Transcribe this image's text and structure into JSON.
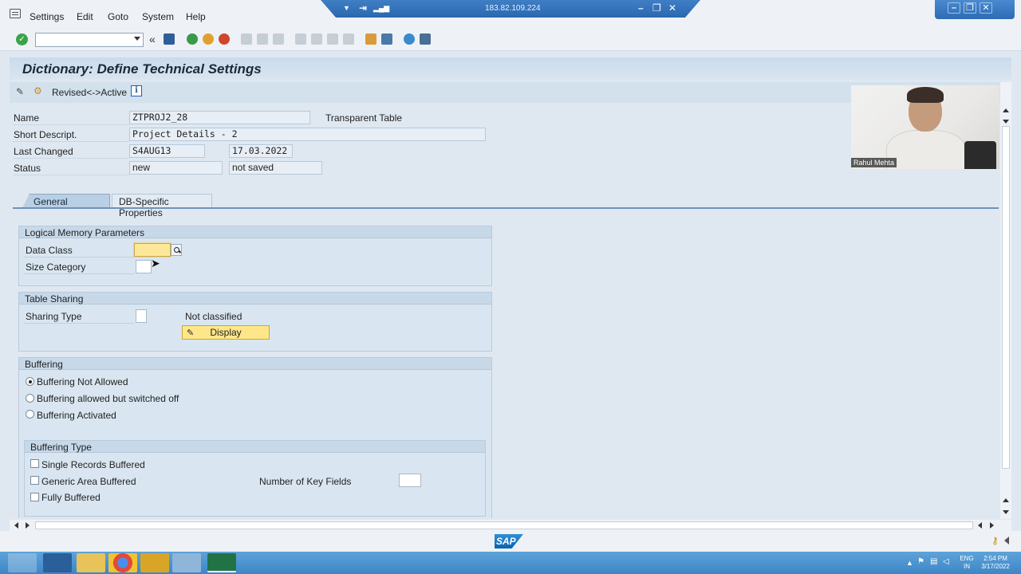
{
  "menu": {
    "items": [
      "Settings",
      "Edit",
      "Goto",
      "System",
      "Help"
    ]
  },
  "remote": {
    "ip": "183.82.109.224"
  },
  "title": "Dictionary: Define Technical Settings",
  "appbar": {
    "toggle_label": "Revised<->Active"
  },
  "header": {
    "name_label": "Name",
    "name_value": "ZTPROJ2_28",
    "table_type": "Transparent Table",
    "short_label": "Short Descript.",
    "short_value": "Project Details - 2",
    "changed_label": "Last Changed",
    "changed_user": "S4AUG13",
    "changed_date": "17.03.2022",
    "status_label": "Status",
    "status_value": "new",
    "status_save": "not saved"
  },
  "tabs": [
    {
      "label": "General Properties",
      "active": true
    },
    {
      "label": "DB-Specific Properties",
      "active": false
    }
  ],
  "logical_memory": {
    "title": "Logical Memory Parameters",
    "data_class_label": "Data Class",
    "data_class_value": "",
    "size_category_label": "Size Category",
    "size_category_value": ""
  },
  "table_sharing": {
    "title": "Table Sharing",
    "sharing_type_label": "Sharing Type",
    "sharing_type_value": "",
    "classification": "Not classified",
    "display_button": "Display"
  },
  "buffering": {
    "title": "Buffering",
    "options": [
      {
        "label": "Buffering Not Allowed",
        "selected": true
      },
      {
        "label": "Buffering allowed but switched off",
        "selected": false
      },
      {
        "label": "Buffering Activated",
        "selected": false
      }
    ],
    "type_title": "Buffering Type",
    "types": [
      {
        "label": "Single Records Buffered",
        "checked": false
      },
      {
        "label": "Generic Area Buffered",
        "checked": false
      },
      {
        "label": "Fully Buffered",
        "checked": false
      }
    ],
    "key_fields_label": "Number of Key Fields",
    "key_fields_value": ""
  },
  "webcam": {
    "name": "Rahul Mehta"
  },
  "taskbar": {
    "lang": "ENG",
    "region": "IN",
    "time": "2:54 PM",
    "date": "3/17/2022"
  },
  "colors": {
    "accent": "#3d86c6",
    "highlight": "#fde89a",
    "title_bg": "#c9dbec"
  }
}
